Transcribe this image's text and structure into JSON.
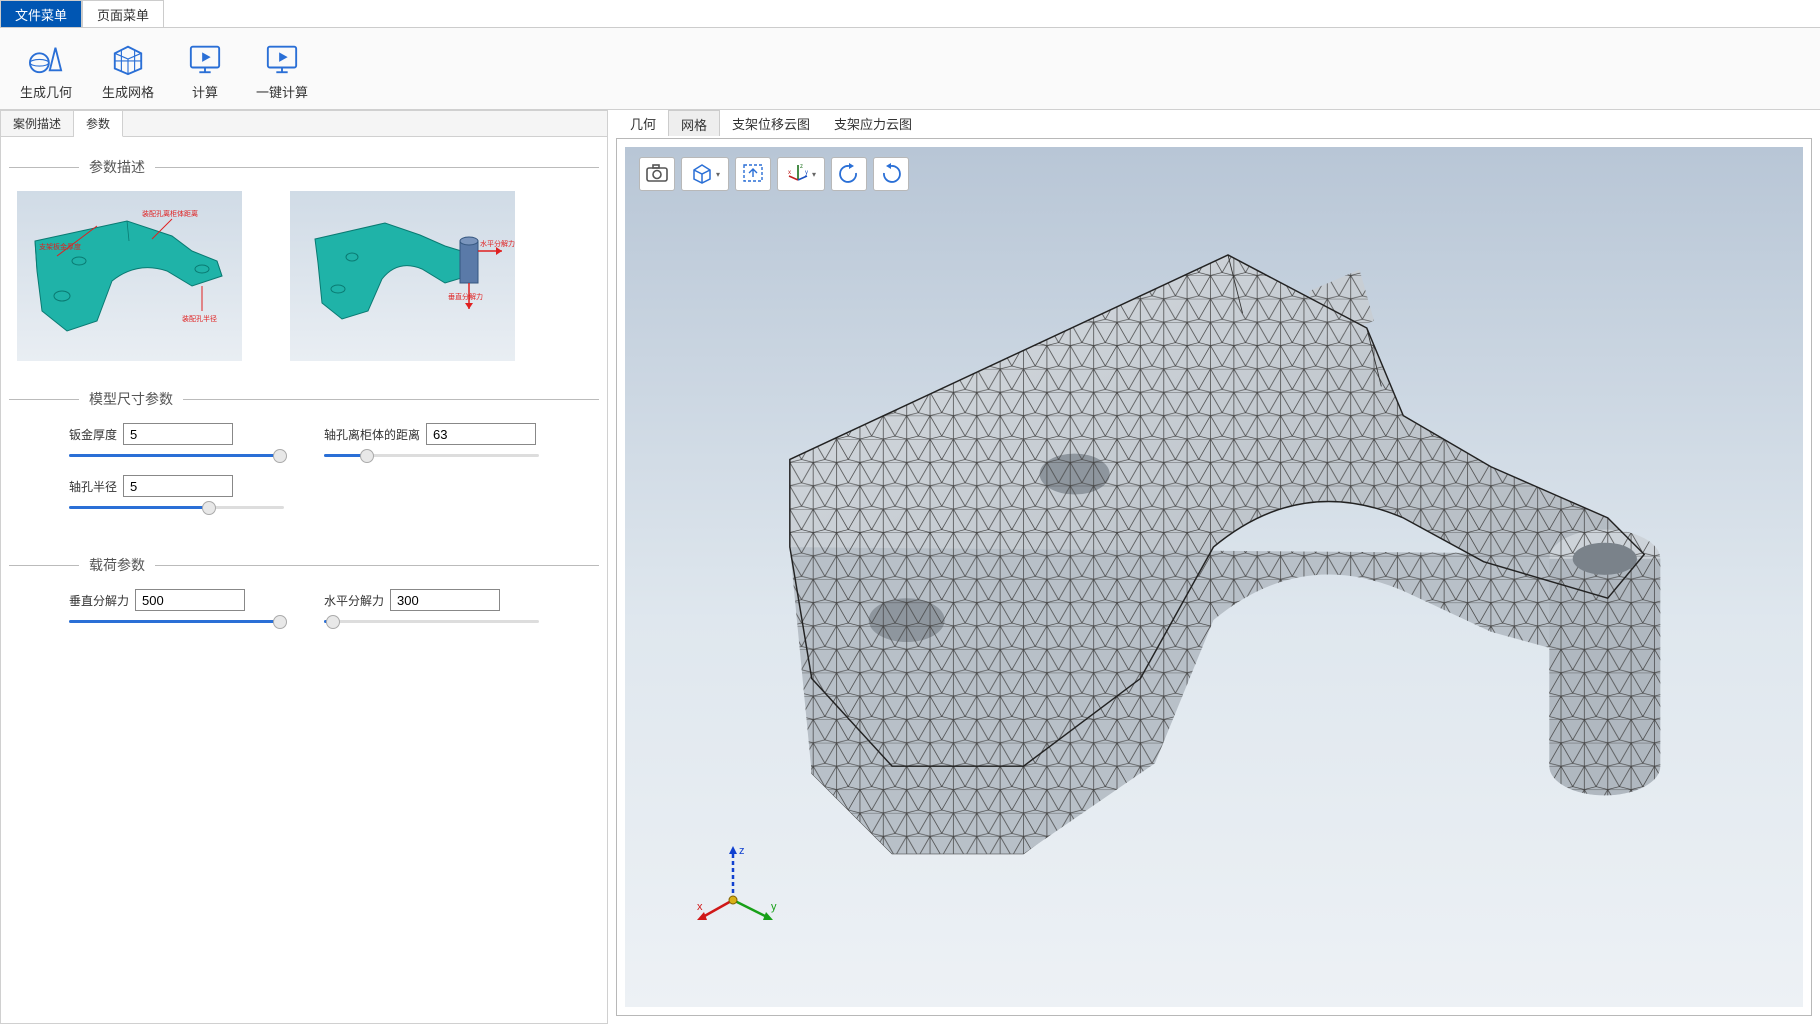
{
  "menu_tabs": {
    "file": "文件菜单",
    "page": "页面菜单"
  },
  "ribbon": {
    "gen_geometry": "生成几何",
    "gen_mesh": "生成网格",
    "compute": "计算",
    "one_click_compute": "一键计算"
  },
  "left_tabs": {
    "case_desc": "案例描述",
    "params": "参数"
  },
  "sections": {
    "param_desc": "参数描述",
    "model_dim": "模型尺寸参数",
    "load": "载荷参数"
  },
  "thumb_labels": {
    "thickness": "支架板金厚度",
    "hole_distance": "装配孔离柜体距离",
    "hole_radius": "装配孔半径",
    "horizontal": "水平分解力",
    "vertical": "垂直分解力"
  },
  "params": {
    "thickness": {
      "label": "钣金厚度",
      "value": "5",
      "fill_pct": 98
    },
    "hole_distance": {
      "label": "轴孔离柜体的距离",
      "value": "63",
      "fill_pct": 20
    },
    "hole_radius": {
      "label": "轴孔半径",
      "value": "5",
      "fill_pct": 65
    },
    "vertical_force": {
      "label": "垂直分解力",
      "value": "500",
      "fill_pct": 98
    },
    "horizontal_force": {
      "label": "水平分解力",
      "value": "300",
      "fill_pct": 4
    }
  },
  "right_tabs": {
    "geometry": "几何",
    "mesh": "网格",
    "disp_cloud": "支架位移云图",
    "stress_cloud": "支架应力云图"
  },
  "viewport_tools": {
    "camera": "camera",
    "cube": "view-cube",
    "fit": "fit-view",
    "axes": "axes-toggle",
    "rotate_left": "rotate-left",
    "rotate_right": "rotate-right"
  },
  "triad": {
    "x": "x",
    "y": "y",
    "z": "z"
  }
}
